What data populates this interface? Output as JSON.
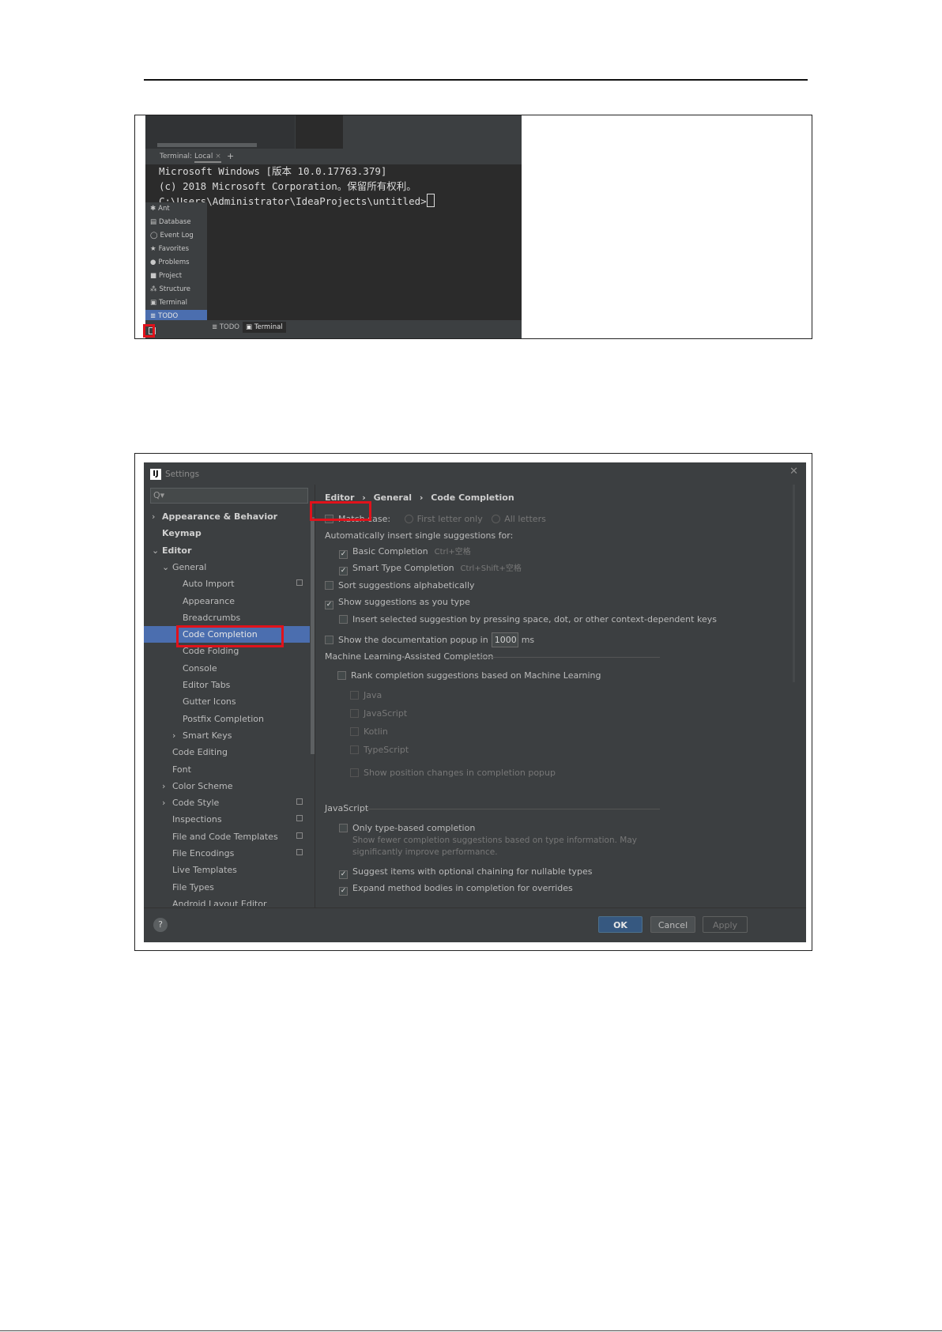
{
  "terminal_screenshot": {
    "tabbar": {
      "label": "Terminal:",
      "tab": "Local",
      "close": "×",
      "add": "+"
    },
    "console_lines": [
      "Microsoft Windows [版本 10.0.17763.379]",
      "(c) 2018 Microsoft Corporation。保留所有权利。",
      "C:\\Users\\Administrator\\IdeaProjects\\untitled>"
    ],
    "tool_popup": [
      {
        "icon": "ant-icon",
        "glyph": "✱",
        "label": "Ant"
      },
      {
        "icon": "database-icon",
        "glyph": "▤",
        "label": "Database"
      },
      {
        "icon": "event-log-icon",
        "glyph": "◯",
        "label": "Event Log"
      },
      {
        "icon": "star-icon",
        "glyph": "★",
        "label": "Favorites"
      },
      {
        "icon": "problems-icon",
        "glyph": "●",
        "label": "Problems"
      },
      {
        "icon": "folder-icon",
        "glyph": "■",
        "label": "Project"
      },
      {
        "icon": "structure-icon",
        "glyph": "⁂",
        "label": "Structure"
      },
      {
        "icon": "terminal-icon",
        "glyph": "▣",
        "label": "Terminal"
      },
      {
        "icon": "todo-icon",
        "glyph": "≣",
        "label": "TODO"
      }
    ],
    "bottom_tabs": [
      {
        "glyph": "≣",
        "label": "TODO"
      },
      {
        "glyph": "▣",
        "label": "Terminal"
      }
    ]
  },
  "settings_screenshot": {
    "title": "Settings",
    "search_glyph": "Q▾",
    "close_glyph": "✕",
    "sidebar": [
      {
        "label": "Appearance & Behavior",
        "arrow": "›",
        "level": 0,
        "bold": true
      },
      {
        "label": "Keymap",
        "arrow": "",
        "level": 0,
        "bold": true
      },
      {
        "label": "Editor",
        "arrow": "⌄",
        "level": 0,
        "bold": true
      },
      {
        "label": "General",
        "arrow": "⌄",
        "level": 1
      },
      {
        "label": "Auto Import",
        "arrow": "",
        "level": 2,
        "copy": true
      },
      {
        "label": "Appearance",
        "arrow": "",
        "level": 2
      },
      {
        "label": "Breadcrumbs",
        "arrow": "",
        "level": 2
      },
      {
        "label": "Code Completion",
        "arrow": "",
        "level": 2,
        "selected": true
      },
      {
        "label": "Code Folding",
        "arrow": "",
        "level": 2
      },
      {
        "label": "Console",
        "arrow": "",
        "level": 2
      },
      {
        "label": "Editor Tabs",
        "arrow": "",
        "level": 2
      },
      {
        "label": "Gutter Icons",
        "arrow": "",
        "level": 2
      },
      {
        "label": "Postfix Completion",
        "arrow": "",
        "level": 2
      },
      {
        "label": "Smart Keys",
        "arrow": "›",
        "level": 2
      },
      {
        "label": "Code Editing",
        "arrow": "",
        "level": 1
      },
      {
        "label": "Font",
        "arrow": "",
        "level": 1
      },
      {
        "label": "Color Scheme",
        "arrow": "›",
        "level": 1
      },
      {
        "label": "Code Style",
        "arrow": "›",
        "level": 1,
        "copy": true
      },
      {
        "label": "Inspections",
        "arrow": "",
        "level": 1,
        "copy": true
      },
      {
        "label": "File and Code Templates",
        "arrow": "",
        "level": 1,
        "copy": true
      },
      {
        "label": "File Encodings",
        "arrow": "",
        "level": 1,
        "copy": true
      },
      {
        "label": "Live Templates",
        "arrow": "",
        "level": 1
      },
      {
        "label": "File Types",
        "arrow": "",
        "level": 1
      },
      {
        "label": "Android Layout Editor",
        "arrow": "",
        "level": 1
      }
    ],
    "breadcrumb": {
      "a": "Editor",
      "b": "General",
      "c": "Code Completion",
      "sep": "›"
    },
    "options": {
      "match_case": "Match case:",
      "first_letter": "First letter only",
      "all_letters": "All letters",
      "auto_insert": "Automatically insert single suggestions for:",
      "basic": "Basic Completion",
      "basic_hint": "Ctrl+空格",
      "smart": "Smart Type Completion",
      "smart_hint": "Ctrl+Shift+空格",
      "sort": "Sort suggestions alphabetically",
      "show_as_type": "Show suggestions as you type",
      "insert_selected": "Insert selected suggestion by pressing space, dot, or other context-dependent keys",
      "doc_popup": "Show the documentation popup in",
      "doc_ms_value": "1000",
      "doc_ms_unit": "ms"
    },
    "ml_section": {
      "title": "Machine Learning-Assisted Completion",
      "rank": "Rank completion suggestions based on Machine Learning",
      "langs": [
        "Java",
        "JavaScript",
        "Kotlin",
        "TypeScript"
      ],
      "show_pos": "Show position changes in completion popup"
    },
    "js_section": {
      "title": "JavaScript",
      "type_based": "Only type-based completion",
      "type_based_desc1": "Show fewer completion suggestions based on type information. May",
      "type_based_desc2": "significantly improve performance.",
      "optional_chaining": "Suggest items with optional chaining for nullable types",
      "expand_method": "Expand method bodies in completion for overrides"
    },
    "footer": {
      "help": "?",
      "ok": "OK",
      "cancel": "Cancel",
      "apply": "Apply"
    }
  }
}
